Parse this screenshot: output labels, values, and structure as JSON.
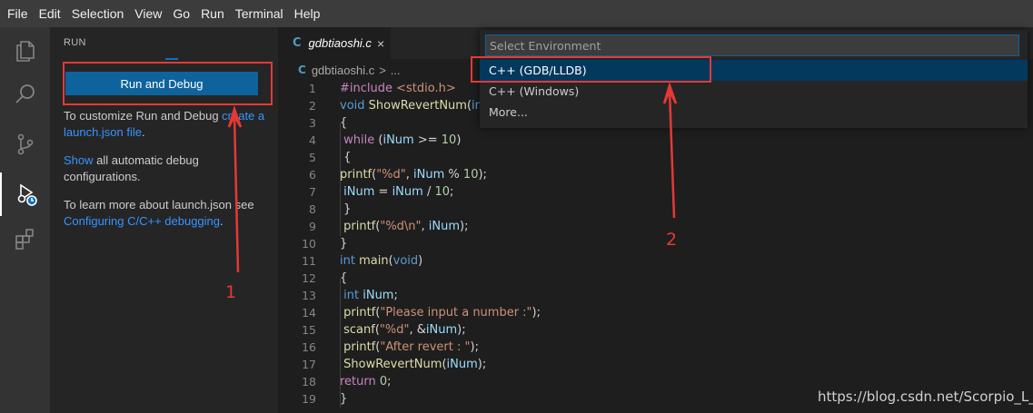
{
  "menubar": {
    "items": [
      "File",
      "Edit",
      "Selection",
      "View",
      "Go",
      "Run",
      "Terminal",
      "Help"
    ]
  },
  "activity_bar": {
    "icons": [
      "explorer-icon",
      "search-icon",
      "source-control-icon",
      "run-debug-icon",
      "extensions-icon"
    ],
    "active": "run-debug-icon"
  },
  "sidebar": {
    "title": "RUN",
    "run_button": "Run and Debug",
    "customize_text": "To customize Run and Debug ",
    "customize_link": "create a launch.json file",
    "customize_end": ".",
    "show_link": "Show",
    "show_text": " all automatic debug configurations.",
    "learn_text": "To learn more about launch.json see ",
    "learn_link": "Configuring C/C++ debugging",
    "learn_end": "."
  },
  "editor": {
    "tab_icon": "C",
    "tab_label": "gdbtiaoshi.c",
    "tab_close": "×",
    "breadcrumb_file": "gdbtiaoshi.c",
    "breadcrumb_sep": ">",
    "breadcrumb_more": "...",
    "line_numbers": [
      "1",
      "2",
      "3",
      "4",
      "5",
      "6",
      "7",
      "8",
      "9",
      "10",
      "11",
      "12",
      "13",
      "14",
      "15",
      "16",
      "17",
      "18",
      "19"
    ]
  },
  "quick_pick": {
    "placeholder": "Select Environment",
    "items": [
      "C++ (GDB/LLDB)",
      "C++ (Windows)",
      "More..."
    ],
    "selected_index": 0
  },
  "annotations": {
    "label_1": "1",
    "label_2": "2",
    "color": "#e53935"
  },
  "watermark": "https://blog.csdn.net/Scorpio_L_",
  "colors": {
    "accent": "#0e639c",
    "link": "#3794ff",
    "selection": "#04395e"
  }
}
